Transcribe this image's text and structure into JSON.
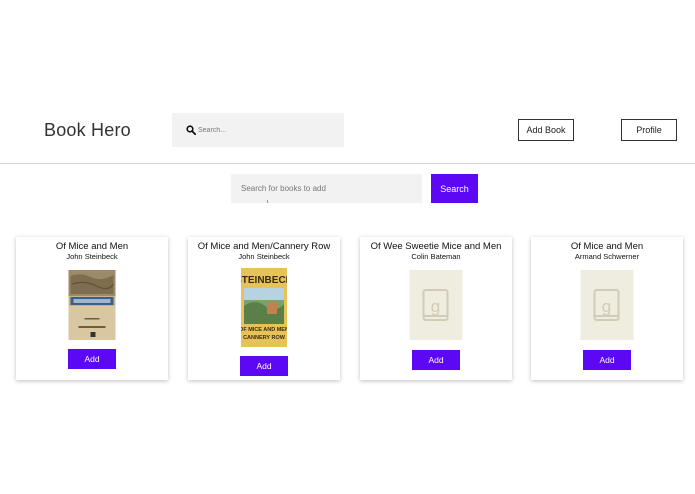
{
  "header": {
    "brand": "Book Hero",
    "search_placeholder": "Search...",
    "add_book_label": "Add Book",
    "profile_label": "Profile"
  },
  "book_search": {
    "placeholder": "Search for books to add",
    "button_label": "Search"
  },
  "books": [
    {
      "title": "Of Mice and Men",
      "author": "John Steinbeck",
      "cover": "of-mice-and-men-cover",
      "add_label": "Add"
    },
    {
      "title": "Of Mice and Men/Cannery Row",
      "author": "John Steinbeck",
      "cover": "steinbeck-cannery-row-cover",
      "cover_text_top": "STEINBECK",
      "cover_text_bottom": "OF MICE AND MEN\nCANNERY ROW",
      "add_label": "Add"
    },
    {
      "title": "Of Wee Sweetie Mice and Men",
      "author": "Colin Bateman",
      "cover": "placeholder-book-icon",
      "add_label": "Add"
    },
    {
      "title": "Of Mice and Men",
      "author": "Armand Schwerner",
      "cover": "placeholder-book-icon",
      "add_label": "Add"
    }
  ],
  "colors": {
    "accent": "#5d08f5",
    "search_bg": "#f2f2f2",
    "placeholder_cover": "#efece0"
  }
}
